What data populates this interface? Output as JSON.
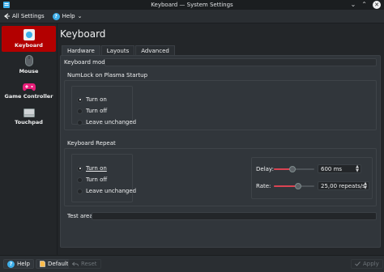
{
  "window": {
    "title": "Keyboard — System Settings",
    "controls": {
      "minimize": "⌄",
      "maximize": "⌃",
      "close": "✕"
    }
  },
  "toolbar": {
    "all_settings_label": "All Settings",
    "help_label": "Help",
    "help_dropdown": "⌄"
  },
  "sidebar": {
    "items": [
      {
        "label": "Keyboard",
        "icon": "keyboard-icon",
        "active": true
      },
      {
        "label": "Mouse",
        "icon": "mouse-icon",
        "active": false
      },
      {
        "label": "Game Controller",
        "icon": "gamepad-icon",
        "active": false
      },
      {
        "label": "Touchpad",
        "icon": "touchpad-icon",
        "active": false
      }
    ]
  },
  "page": {
    "title": "Keyboard",
    "tabs": [
      {
        "label": "Hardware",
        "active": true
      },
      {
        "label": "Layouts",
        "active": false
      },
      {
        "label": "Advanced",
        "active": false
      }
    ]
  },
  "hardware": {
    "keyboard_model_label": "Keyboard model:",
    "keyboard_model_value": "",
    "numlock": {
      "title": "NumLock on Plasma Startup",
      "options": [
        {
          "label": "Turn on",
          "checked": true
        },
        {
          "label": "Turn off",
          "checked": false
        },
        {
          "label": "Leave unchanged",
          "checked": false
        }
      ]
    },
    "repeat": {
      "title": "Keyboard Repeat",
      "options": [
        {
          "label": "Turn on",
          "checked": true
        },
        {
          "label": "Turn off",
          "checked": false
        },
        {
          "label": "Leave unchanged",
          "checked": false
        }
      ],
      "delay_label": "Delay:",
      "delay_value": "600 ms",
      "delay_level": 0.45,
      "rate_label": "Rate:",
      "rate_value": "25,00 repeats/s",
      "rate_level": 0.6
    },
    "test_area_label": "Test area:",
    "test_area_value": ""
  },
  "footer": {
    "help_label": "Help",
    "defaults_label": "Defaults",
    "reset_label": "Reset",
    "apply_label": "Apply"
  },
  "colors": {
    "accent": "#3daee9",
    "active_item": "#b30000",
    "slider_fill": "#da4453"
  }
}
